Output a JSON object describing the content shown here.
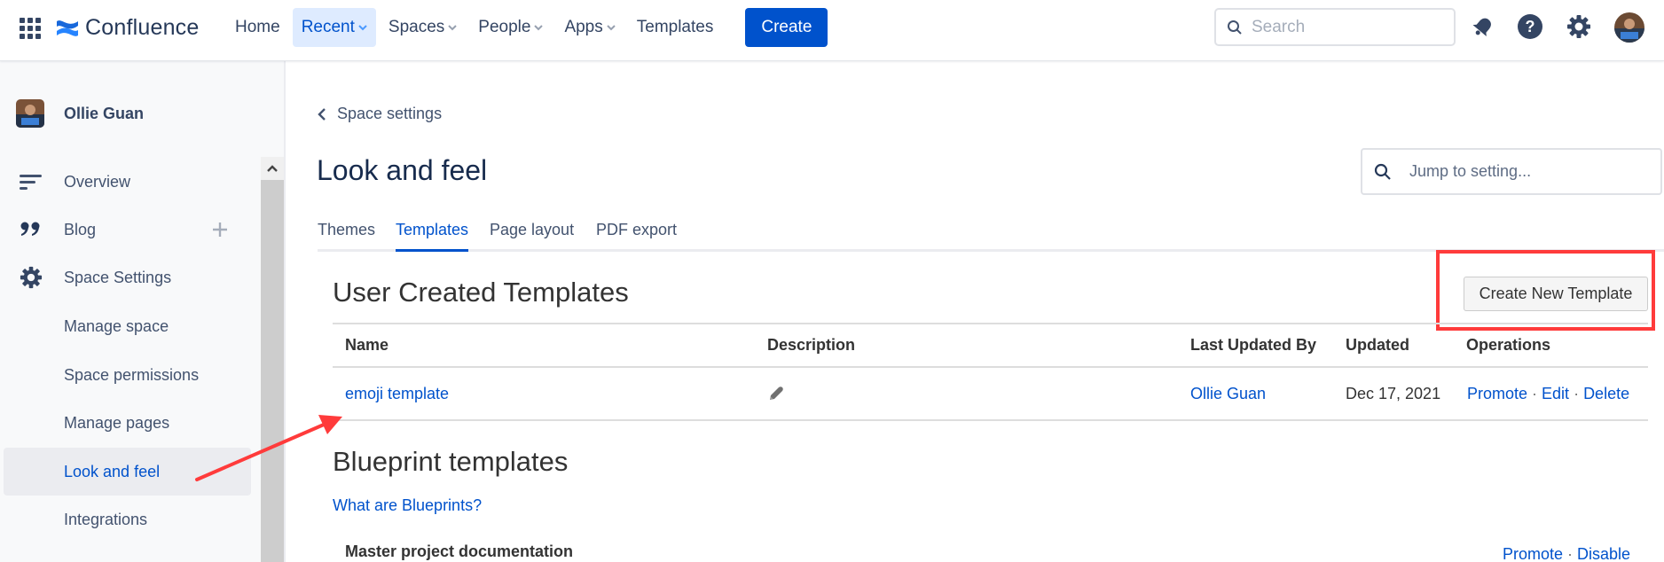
{
  "header": {
    "app_name": "Confluence",
    "nav": [
      {
        "label": "Home",
        "dropdown": false,
        "active": false
      },
      {
        "label": "Recent",
        "dropdown": true,
        "active": true
      },
      {
        "label": "Spaces",
        "dropdown": true,
        "active": false
      },
      {
        "label": "People",
        "dropdown": true,
        "active": false
      },
      {
        "label": "Apps",
        "dropdown": true,
        "active": false
      },
      {
        "label": "Templates",
        "dropdown": false,
        "active": false
      }
    ],
    "create_label": "Create",
    "search_placeholder": "Search",
    "icons": [
      "notifications-bell-icon",
      "help-icon",
      "settings-gear-icon",
      "user-avatar"
    ]
  },
  "sidebar": {
    "space_name": "Ollie Guan",
    "items": [
      {
        "label": "Overview",
        "icon": "overview-lines-icon"
      },
      {
        "label": "Blog",
        "icon": "quote-icon",
        "action": "add"
      },
      {
        "label": "Space Settings",
        "icon": "gear-icon"
      },
      {
        "label": "Manage space"
      },
      {
        "label": "Space permissions"
      },
      {
        "label": "Manage pages"
      },
      {
        "label": "Look and feel",
        "active": true
      },
      {
        "label": "Integrations"
      }
    ]
  },
  "main": {
    "back_label": "Space settings",
    "title": "Look and feel",
    "jump_placeholder": "Jump to setting...",
    "tabs": [
      {
        "label": "Themes",
        "active": false
      },
      {
        "label": "Templates",
        "active": true
      },
      {
        "label": "Page layout",
        "active": false
      },
      {
        "label": "PDF export",
        "active": false
      }
    ],
    "user_templates": {
      "title": "User Created Templates",
      "create_button": "Create New Template",
      "columns": [
        "Name",
        "Description",
        "Last Updated By",
        "Updated",
        "Operations"
      ],
      "rows": [
        {
          "name": "emoji template",
          "description_icon": "pencil-icon",
          "last_updated_by": "Ollie Guan",
          "updated": "Dec 17, 2021",
          "operations": [
            "Promote",
            "Edit",
            "Delete"
          ]
        }
      ]
    },
    "blueprints": {
      "title": "Blueprint templates",
      "help_link": "What are Blueprints?",
      "items": [
        {
          "name": "Master project documentation",
          "operations": [
            "Promote",
            "Disable"
          ]
        }
      ]
    }
  },
  "annotations": {
    "highlight_color": "#ff3b3b"
  }
}
